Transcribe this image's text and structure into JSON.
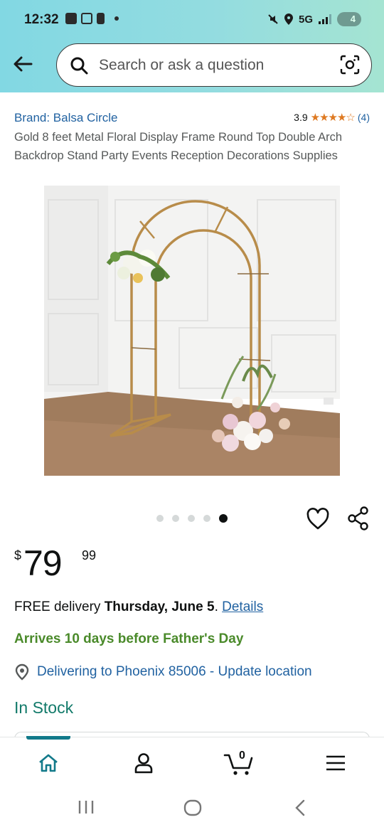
{
  "status_bar": {
    "time": "12:32",
    "network": "5G",
    "battery": "4"
  },
  "search": {
    "placeholder": "Search or ask a question"
  },
  "product": {
    "brand": "Brand: Balsa Circle",
    "rating_value": "3.9",
    "stars": "★★★★☆",
    "rating_count": "(4)",
    "title": "Gold 8 feet Metal Floral Display Frame Round Top Double Arch Backdrop Stand Party Events Reception Decorations Supplies",
    "image_count": 5,
    "active_image": 5
  },
  "price": {
    "currency": "$",
    "whole": "79",
    "fraction": "99"
  },
  "delivery": {
    "prefix": "FREE delivery ",
    "date": "Thursday, June 5",
    "suffix": ". ",
    "details_link": "Details"
  },
  "arrives": "Arrives 10 days before Father's Day",
  "location": "Delivering to Phoenix 85006 - Update location",
  "stock": "In Stock",
  "bottom_nav": {
    "cart_count": "0"
  },
  "colors": {
    "header_gradient_start": "#82d8e3",
    "header_gradient_end": "#a5e4d2",
    "link": "#2162a1",
    "star": "#de7921",
    "promo_green": "#4a8a2a",
    "stock_teal": "#127a6a"
  }
}
